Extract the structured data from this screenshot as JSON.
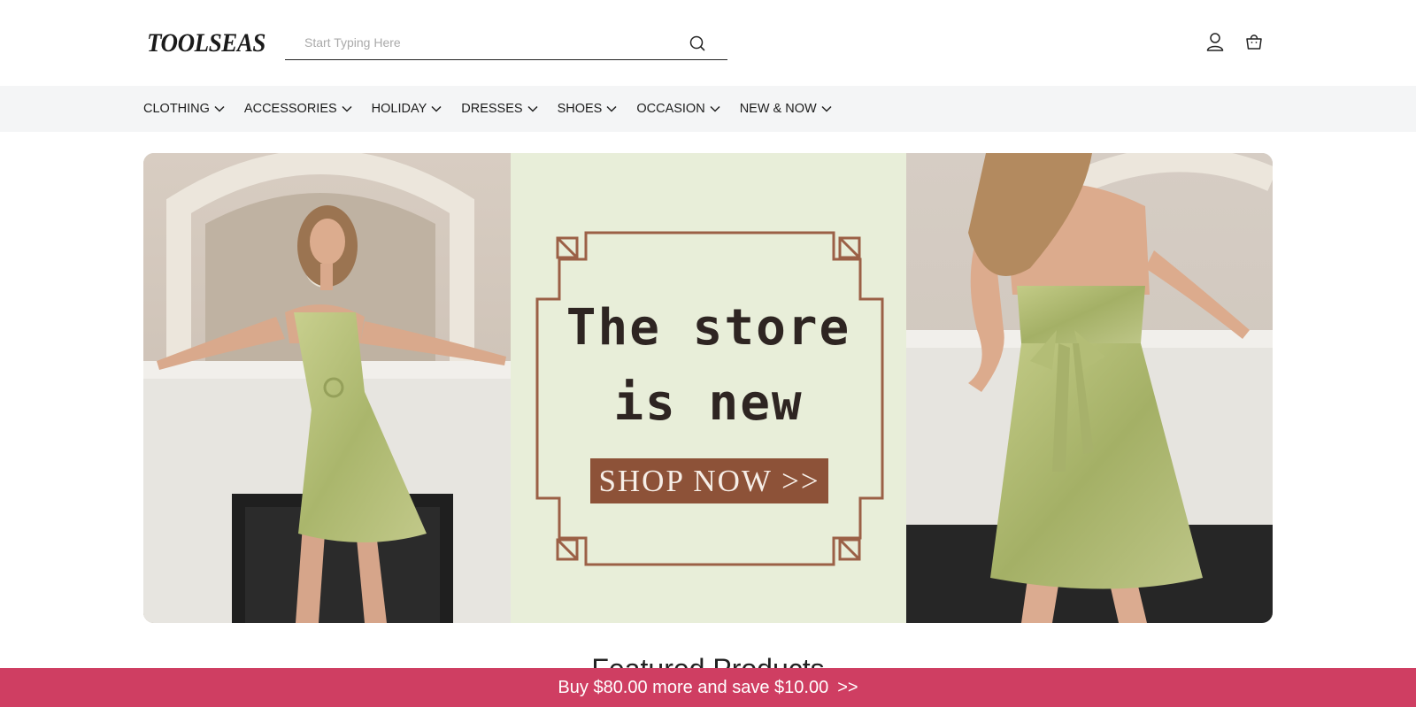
{
  "header": {
    "logo": "TOOLSEAS",
    "search_placeholder": "Start Typing Here"
  },
  "nav": {
    "items": [
      {
        "label": "CLOTHING"
      },
      {
        "label": "ACCESSORIES"
      },
      {
        "label": "HOLIDAY"
      },
      {
        "label": "DRESSES"
      },
      {
        "label": "SHOES"
      },
      {
        "label": "OCCASION"
      },
      {
        "label": "NEW & NOW"
      }
    ]
  },
  "banner": {
    "headline_line1": "The store",
    "headline_line2": "is new",
    "cta": "SHOP NOW >>",
    "colors": {
      "panel_bg": "#e8eed9",
      "frame": "#9b6046",
      "cta_bg": "#8d5238",
      "dress": "#b6c07a"
    }
  },
  "featured": {
    "title": "Featured Products"
  },
  "promo": {
    "text": "Buy $80.00 more and save $10.00",
    "arrows": ">>",
    "color": "#cf3e62"
  },
  "icons": {
    "search": "search-icon",
    "account": "user-icon",
    "cart": "shopping-bag-icon",
    "nav_chevron": "chevron-down-icon"
  }
}
